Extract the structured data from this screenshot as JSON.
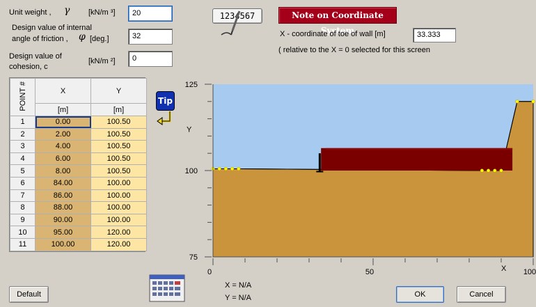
{
  "params": {
    "unit_weight_label": "Unit weight ,",
    "unit_weight_symbol": "γ",
    "unit_weight_unit": "[kN/m ³]",
    "unit_weight_value": "20",
    "friction_label_1": "Design value of internal",
    "friction_label_2": "angle of friction ,",
    "friction_symbol": "φ",
    "friction_unit": "[deg.]",
    "friction_value": "32",
    "cohesion_label_1": "Design value of",
    "cohesion_label_2": "cohesion,  c",
    "cohesion_unit": "[kN/m ²]",
    "cohesion_value": "0"
  },
  "toolbar": {
    "counter_text": "1234567",
    "note_label": "Note on Coordinate System",
    "toe_label": "X - coordinate of toe of wall  [m]",
    "toe_value": "33.333",
    "relative_note": "( relative to the  X = 0  selected for this screen",
    "tip_label": "Tip"
  },
  "table": {
    "rowhead": "POINT #",
    "col_x": "X",
    "col_y": "Y",
    "unit_x": "[m]",
    "unit_y": "[m]",
    "rows": [
      {
        "n": "1",
        "x": "0.00",
        "y": "100.50"
      },
      {
        "n": "2",
        "x": "2.00",
        "y": "100.50"
      },
      {
        "n": "3",
        "x": "4.00",
        "y": "100.50"
      },
      {
        "n": "4",
        "x": "6.00",
        "y": "100.50"
      },
      {
        "n": "5",
        "x": "8.00",
        "y": "100.50"
      },
      {
        "n": "6",
        "x": "84.00",
        "y": "100.00"
      },
      {
        "n": "7",
        "x": "86.00",
        "y": "100.00"
      },
      {
        "n": "8",
        "x": "88.00",
        "y": "100.00"
      },
      {
        "n": "9",
        "x": "90.00",
        "y": "100.00"
      },
      {
        "n": "10",
        "x": "95.00",
        "y": "120.00"
      },
      {
        "n": "11",
        "x": "100.00",
        "y": "120.00"
      }
    ]
  },
  "plot": {
    "y_ticks": [
      "125",
      "100",
      "75"
    ],
    "x_ticks": [
      "0",
      "50",
      "100"
    ],
    "y_label": "Y",
    "x_label": "X",
    "x_readout": "X = N/A",
    "y_readout": "Y = N/A",
    "sky_color": "#a6caf0",
    "soil_color": "#c9943c",
    "wall_color": "#7a0000"
  },
  "footer": {
    "default_label": "Default",
    "ok_label": "OK",
    "cancel_label": "Cancel"
  }
}
